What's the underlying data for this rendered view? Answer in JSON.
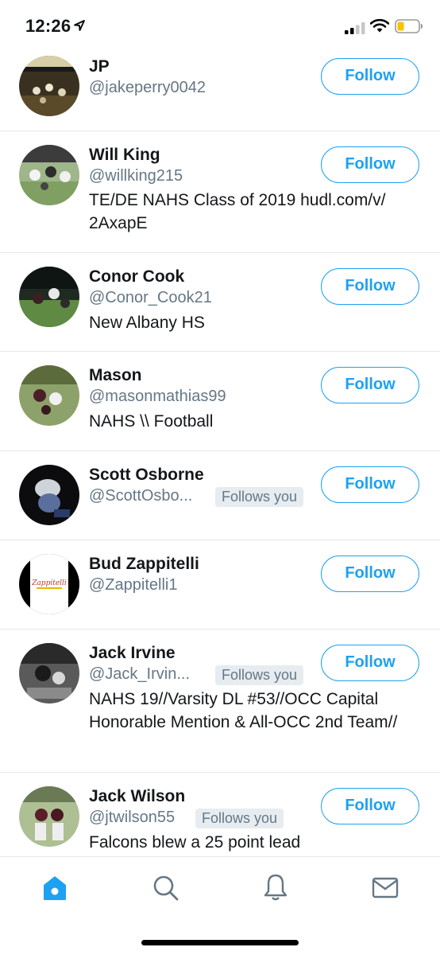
{
  "status_bar": {
    "time": "12:26"
  },
  "follow_label": "Follow",
  "follows_you_label": "Follows you",
  "users": [
    {
      "name": "JP",
      "handle": "@jakeperry0042",
      "bio": ""
    },
    {
      "name": "Will King",
      "handle": "@willking215",
      "bio": "TE/DE NAHS Class of 2019 hudl.com/v/ 2AxapE"
    },
    {
      "name": "Conor Cook",
      "handle": "@Conor_Cook21",
      "bio": "New Albany HS"
    },
    {
      "name": "Mason",
      "handle": "@masonmathias99",
      "bio": "NAHS \\\\ Football"
    },
    {
      "name": "Scott Osborne",
      "handle": "@ScottOsbo...",
      "bio": ""
    },
    {
      "name": "Bud Zappitelli",
      "handle": "@Zappitelli1",
      "bio": "",
      "avatar_text": "Zappitelli"
    },
    {
      "name": "Jack Irvine",
      "handle": "@Jack_Irvin...",
      "bio": "NAHS 19//Varsity DL #53//OCC Capital Honorable Mention & All-OCC 2nd Team//"
    },
    {
      "name": "Jack Wilson",
      "handle": "@jtwilson55",
      "bio": "Falcons blew a 25 point lead"
    }
  ],
  "tabs": [
    "home-icon",
    "search-icon",
    "notifications-icon",
    "messages-icon"
  ],
  "colors": {
    "accent": "#1da1f2",
    "secondary_text": "#657786",
    "badge_bg": "#e6ecf0",
    "divider": "#e1e8ed"
  }
}
